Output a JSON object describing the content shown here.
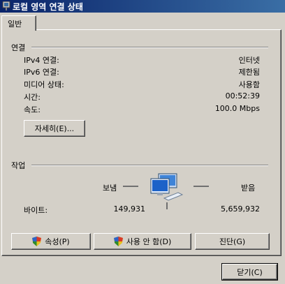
{
  "window": {
    "title": "로컬 영역 연결 상태"
  },
  "tabs": [
    {
      "label": "일반"
    }
  ],
  "connection": {
    "section_label": "연결",
    "rows": [
      {
        "label": "IPv4 연결:",
        "value": "인터넷"
      },
      {
        "label": "IPv6 연결:",
        "value": "제한됨"
      },
      {
        "label": "미디어 상태:",
        "value": "사용함"
      },
      {
        "label": "시간:",
        "value": "00:52:39"
      },
      {
        "label": "속도:",
        "value": "100.0 Mbps"
      }
    ],
    "details_button": "자세히(E)..."
  },
  "activity": {
    "section_label": "작업",
    "sent_label": "보냄",
    "received_label": "받음",
    "bytes_label": "바이트:",
    "bytes_sent": "149,931",
    "bytes_received": "5,659,932"
  },
  "buttons": {
    "properties": "속성(P)",
    "disable": "사용 안 함(D)",
    "diagnose": "진단(G)",
    "close": "닫기(C)"
  },
  "icons": {
    "title": "network-connection-icon",
    "activity": "network-computers-icon",
    "shield": "uac-shield-icon"
  },
  "colors": {
    "title_bar": "#0a246a",
    "face": "#d4d0c8"
  }
}
